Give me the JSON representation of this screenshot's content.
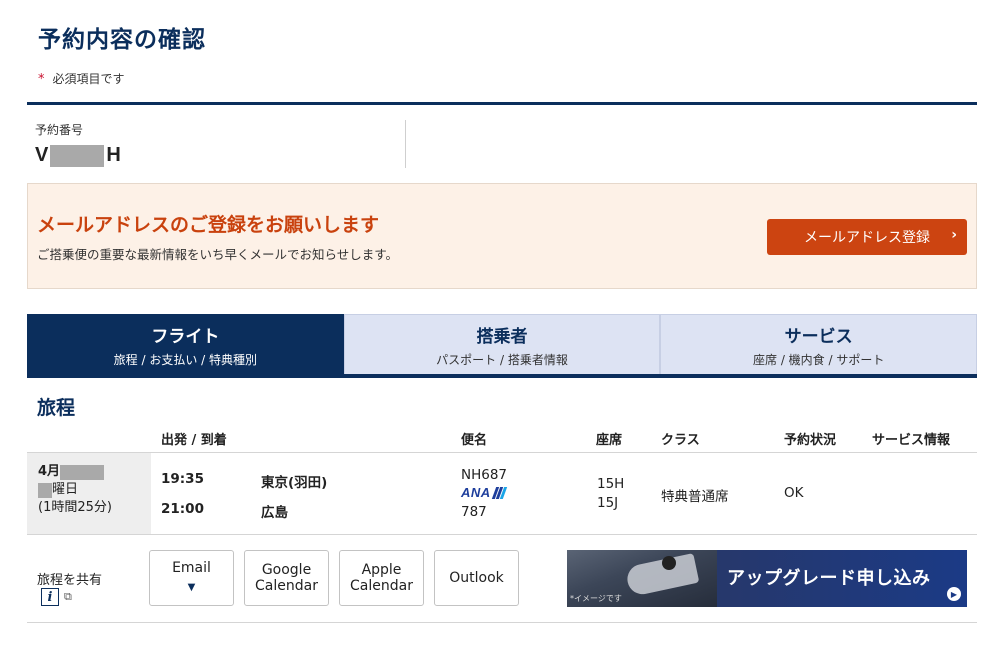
{
  "page": {
    "title": "予約内容の確認",
    "required_star": "*",
    "required_note": "必須項目です"
  },
  "booking": {
    "label": "予約番号",
    "number_prefix": "V",
    "number_suffix": "H"
  },
  "email_banner": {
    "title": "メールアドレスのご登録をお願いします",
    "description": "ご搭乗便の重要な最新情報をいち早くメールでお知らせします。",
    "button_label": "メールアドレス登録",
    "button_chevron": "›",
    "accent_color": "#cc4411"
  },
  "tabs": [
    {
      "title": "フライト",
      "subtitle": "旅程 / お支払い / 特典種別",
      "active": true
    },
    {
      "title": "搭乗者",
      "subtitle": "パスポート / 搭乗者情報",
      "active": false
    },
    {
      "title": "サービス",
      "subtitle": "座席 / 機内食 / サポート",
      "active": false
    }
  ],
  "itinerary": {
    "section_title": "旅程",
    "headers": {
      "depart_arrive": "出発 / 到着",
      "flight": "便名",
      "seat": "座席",
      "class": "クラス",
      "status": "予約状況",
      "service": "サービス情報"
    },
    "row": {
      "date_month": "4月",
      "weekday_suffix": "曜日",
      "duration": "(1時間25分)",
      "depart_time": "19:35",
      "arrive_time": "21:00",
      "depart_airport": "東京(羽田)",
      "arrive_airport": "広島",
      "flight_number": "NH687",
      "airline_logo": "ANA",
      "aircraft": "787",
      "seat_1": "15H",
      "seat_2": "15J",
      "class": "特典普通席",
      "status": "OK",
      "service": ""
    }
  },
  "share": {
    "label": "旅程を共有",
    "info_icon": "i",
    "external_icon": "⧉",
    "buttons": {
      "email": "Email",
      "email_caret": "▼",
      "google_line1": "Google",
      "google_line2": "Calendar",
      "apple_line1": "Apple",
      "apple_line2": "Calendar",
      "outlook": "Outlook"
    }
  },
  "upgrade_banner": {
    "text": "アップグレード申し込み",
    "note": "*イメージです",
    "arrow": "▶"
  },
  "colors": {
    "navy": "#0b2e5c",
    "tab_inactive": "#dde3f3",
    "banner_bg": "#fdf1e7"
  }
}
